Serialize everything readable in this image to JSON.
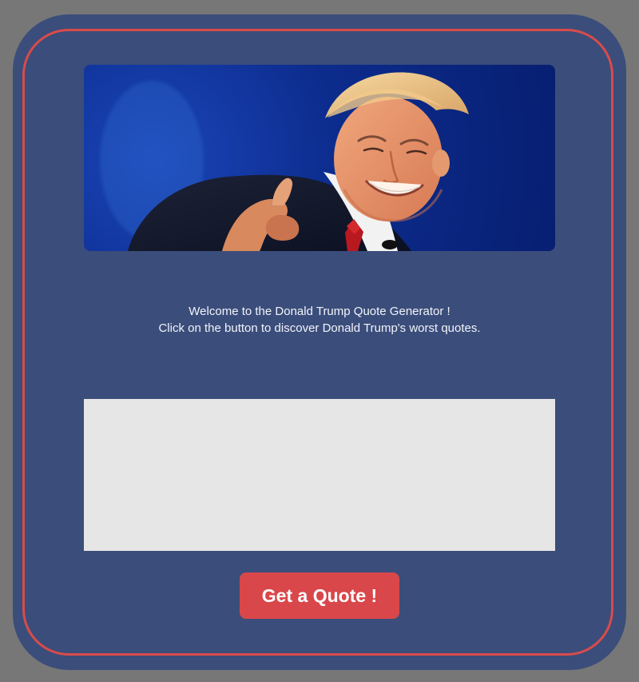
{
  "hero": {
    "alt_subject": "Donald Trump portrait"
  },
  "welcome": {
    "line1": "Welcome to the Donald Trump Quote Generator !",
    "line2": "Click on the button to discover Donald Trump's worst quotes."
  },
  "quote": {
    "text": ""
  },
  "button": {
    "label": "Get a Quote !"
  },
  "colors": {
    "page_bg": "#777777",
    "frame_bg": "#3b4d7a",
    "frame_border": "#d94b4b",
    "quote_box_bg": "#e6e6e6",
    "button_bg": "#d9474b",
    "text": "#f2f4fb"
  }
}
